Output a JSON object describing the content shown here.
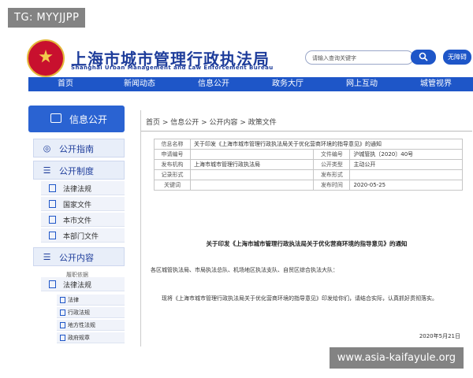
{
  "watermark_top": "TG: MYYJJPP",
  "watermark_bottom": "www.asia-kaifayule.org",
  "header": {
    "title": "上海市城市管理行政执法局",
    "subtitle": "Shanghai Urban Management and Law Enforcement Bureau",
    "search_placeholder": "请输入查询关键字",
    "help_label": "无障碍"
  },
  "nav": [
    "首页",
    "新闻动态",
    "信息公开",
    "政务大厅",
    "网上互动",
    "城管视界"
  ],
  "sidebar": {
    "head": "信息公开",
    "sections": [
      "公开指南",
      "公开制度",
      "公开内容"
    ],
    "policy_items": [
      "法律法规",
      "国家文件",
      "本市文件",
      "本部门文件"
    ],
    "content_label": "履职依据",
    "content_sub": "法律法规",
    "mini_items": [
      "法律",
      "行政法规",
      "地方性法规",
      "政府规章"
    ]
  },
  "main": {
    "breadcrumb": "首页 > 信息公开 > 公开内容 > 政策文件",
    "meta": {
      "name_k": "信息名称",
      "name_v": "关于印发《上海市城市管理行政执法局关于优化营商环境的指导意见》的通知",
      "apply_k": "申请编号",
      "docno_k": "文件编号",
      "docno_v": "沪城管执〔2020〕40号",
      "org_k": "发布机构",
      "org_v": "上海市城市管理行政执法局",
      "type_k": "公开类型",
      "type_v": "主动公开",
      "record_k": "记录形式",
      "form_k": "发布形式",
      "kw_k": "关键词",
      "date_k": "发布时间",
      "date_v": "2020-05-25"
    },
    "doc_title": "关于印发《上海市城市管理行政执法局关于优化营商环境的指导意见》的通知",
    "doc_to": "各区城管执法局、市局执法总队、机场地区执法支队、自贸区综合执法大队：",
    "doc_body": "现将《上海市城市管理行政执法局关于优化营商环境的指导意见》印发给你们，请结合实际，认真抓好贯彻落实。",
    "doc_date": "2020年5月21日"
  },
  "colors": {
    "brand": "#1e56c8",
    "title": "#1e3d9b",
    "emblem": "#c8102e"
  }
}
